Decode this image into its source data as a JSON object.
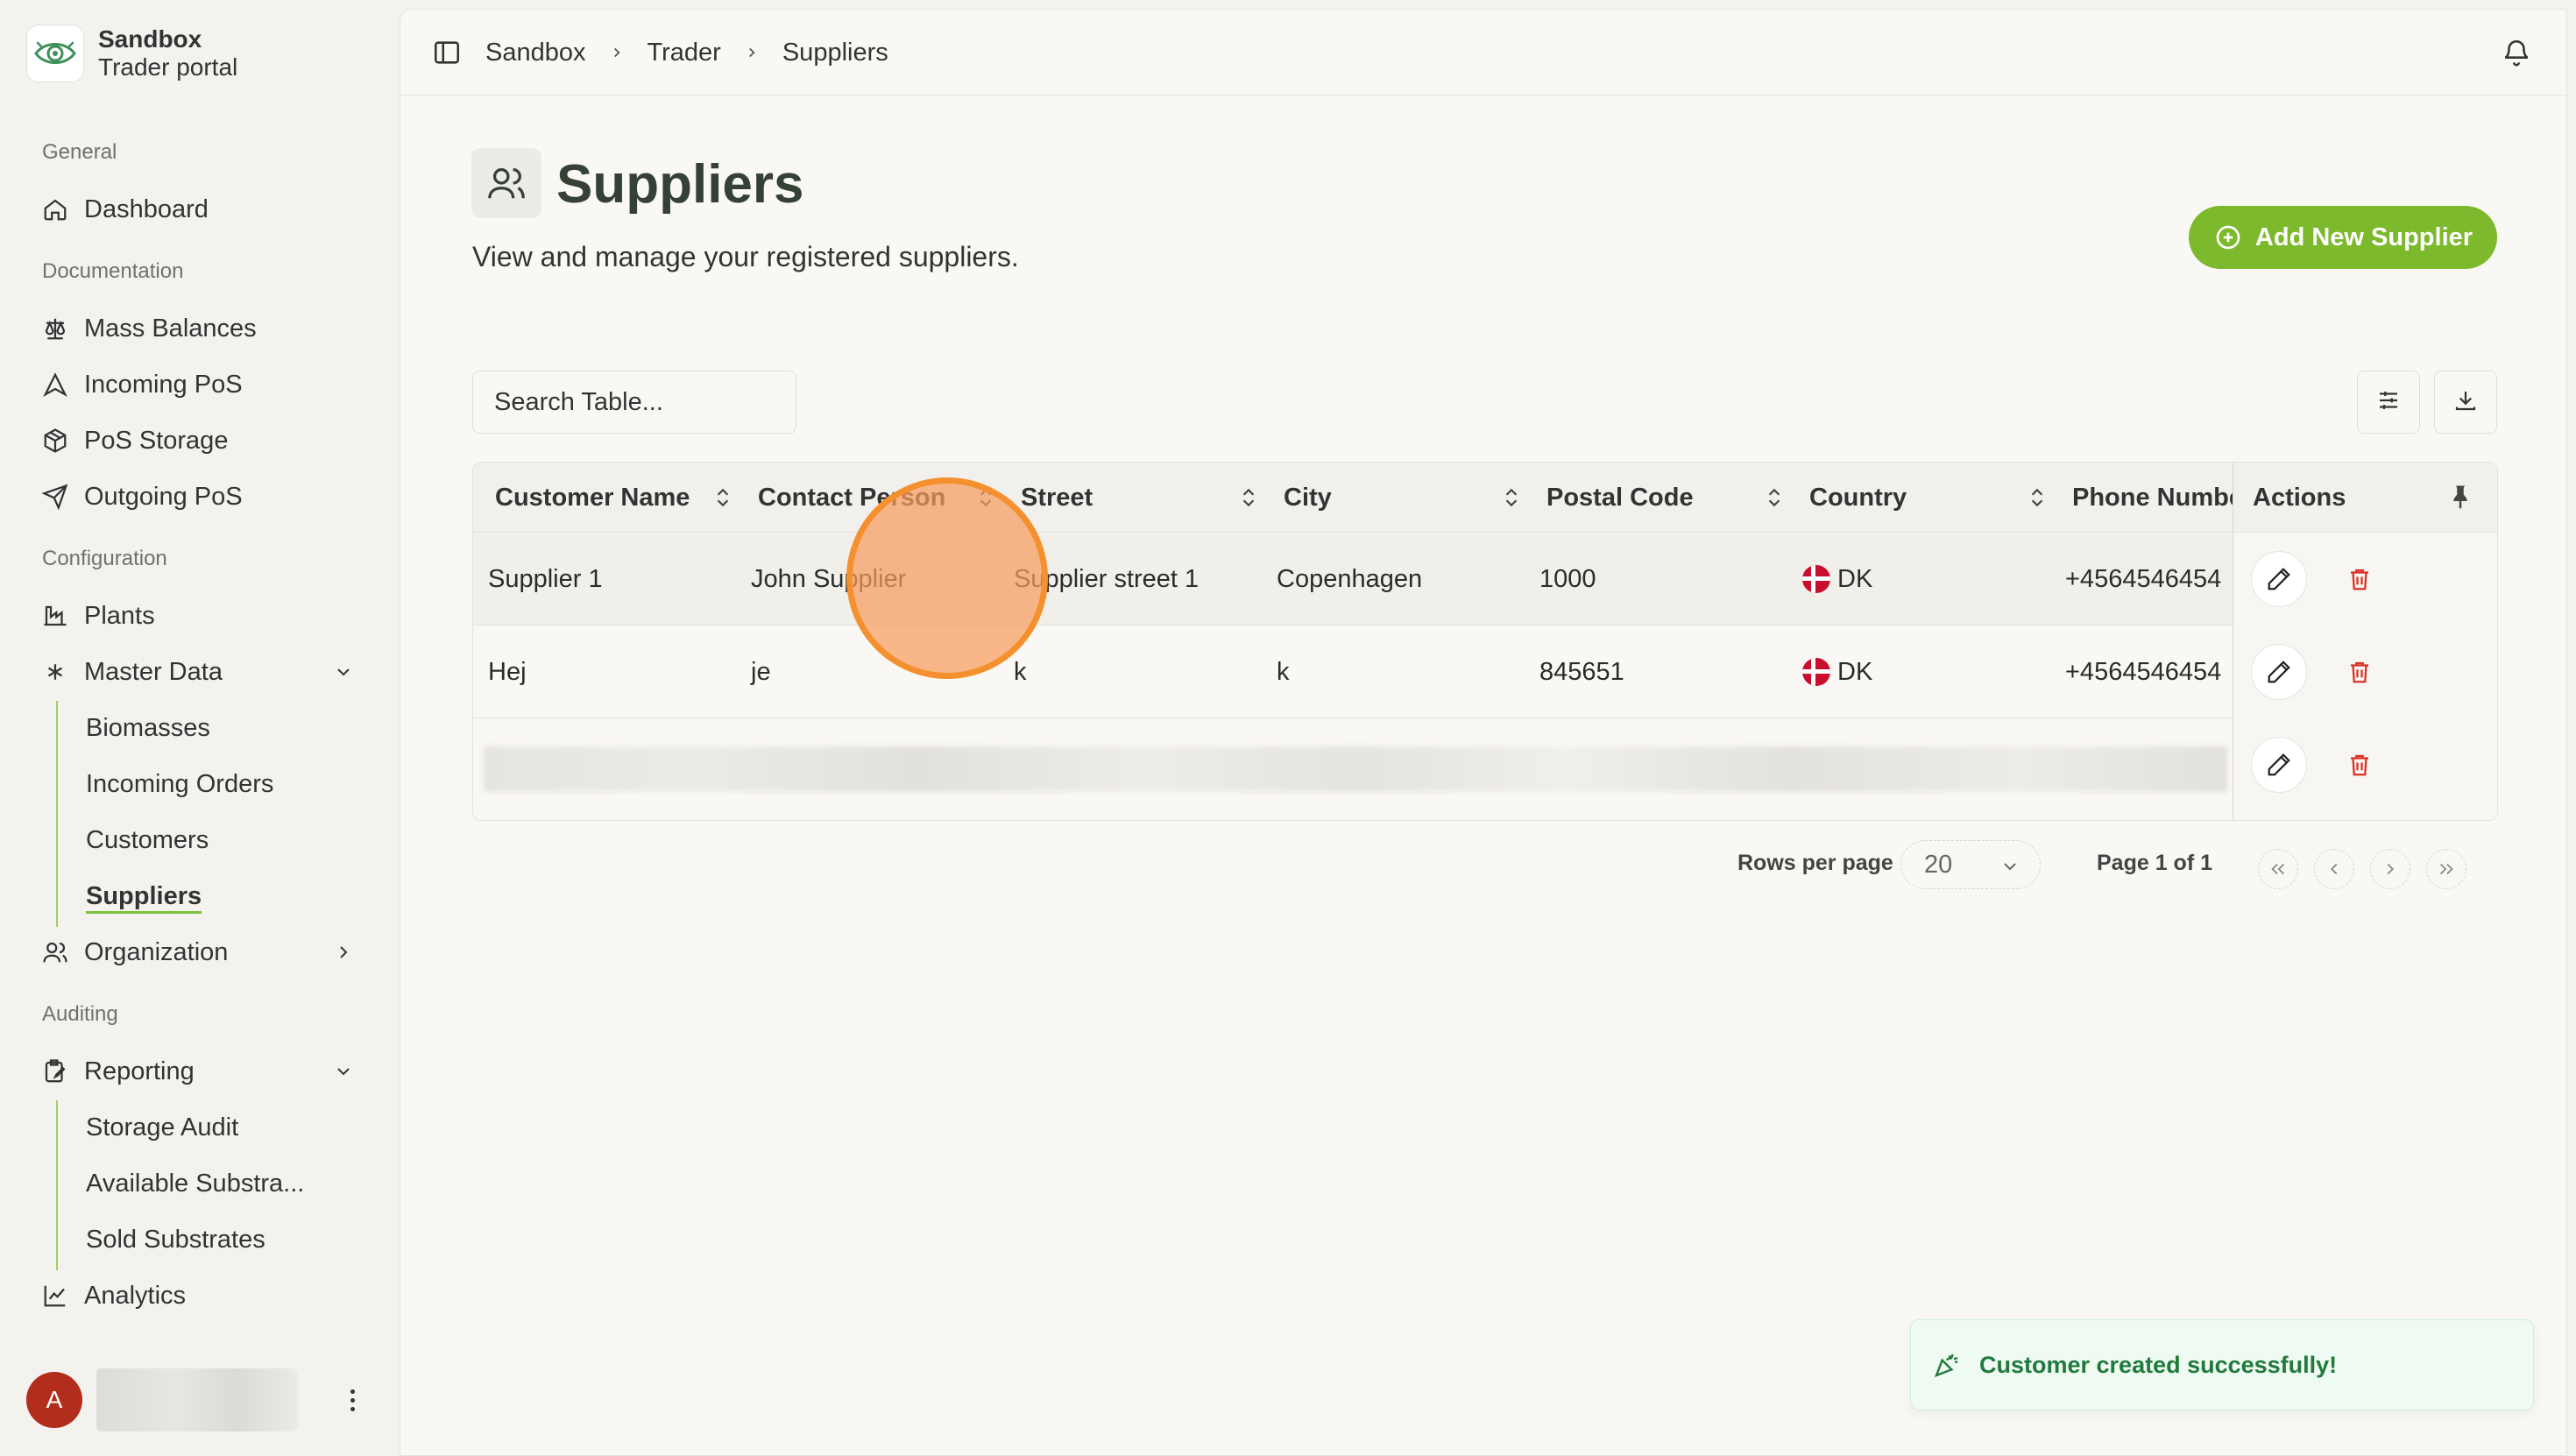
{
  "brand": {
    "title": "Sandbox",
    "subtitle": "Trader portal"
  },
  "sidebar": {
    "sections": {
      "general": "General",
      "documentation": "Documentation",
      "configuration": "Configuration",
      "auditing": "Auditing"
    },
    "items": {
      "dashboard": "Dashboard",
      "mass_balances": "Mass Balances",
      "incoming_pos": "Incoming PoS",
      "pos_storage": "PoS Storage",
      "outgoing_pos": "Outgoing PoS",
      "plants": "Plants",
      "master_data": "Master Data",
      "organization": "Organization",
      "reporting": "Reporting",
      "analytics": "Analytics"
    },
    "master_data_children": [
      "Biomasses",
      "Incoming Orders",
      "Customers",
      "Suppliers"
    ],
    "reporting_children": [
      "Storage Audit",
      "Available Substra...",
      "Sold Substrates"
    ],
    "active": "Suppliers",
    "user_initial": "A"
  },
  "breadcrumb": [
    "Sandbox",
    "Trader",
    "Suppliers"
  ],
  "page": {
    "title": "Suppliers",
    "subtitle": "View and manage your registered suppliers.",
    "add_button": "Add New Supplier"
  },
  "search": {
    "placeholder": "Search Table..."
  },
  "table": {
    "columns": [
      "Customer Name",
      "Contact Person",
      "Street",
      "City",
      "Postal Code",
      "Country",
      "Phone Numbe",
      "Actions"
    ],
    "rows": [
      {
        "customer_name": "Supplier 1",
        "contact_person": "John Supplier",
        "street": "Supplier street 1",
        "city": "Copenhagen",
        "postal_code": "1000",
        "country": "DK",
        "phone": "+4564546454"
      },
      {
        "customer_name": "Hej",
        "contact_person": "je",
        "street": "k",
        "city": "k",
        "postal_code": "845651",
        "country": "DK",
        "phone": "+4564546454"
      }
    ]
  },
  "pagination": {
    "rows_per_page_label": "Rows per page",
    "rows_per_page": "20",
    "page_info": "Page 1 of 1"
  },
  "toast": {
    "message": "Customer created successfully!"
  },
  "colors": {
    "accent": "#7cb92c",
    "toast_text": "#1f7a3c",
    "delete": "#d93025",
    "avatar": "#b22d1c"
  }
}
